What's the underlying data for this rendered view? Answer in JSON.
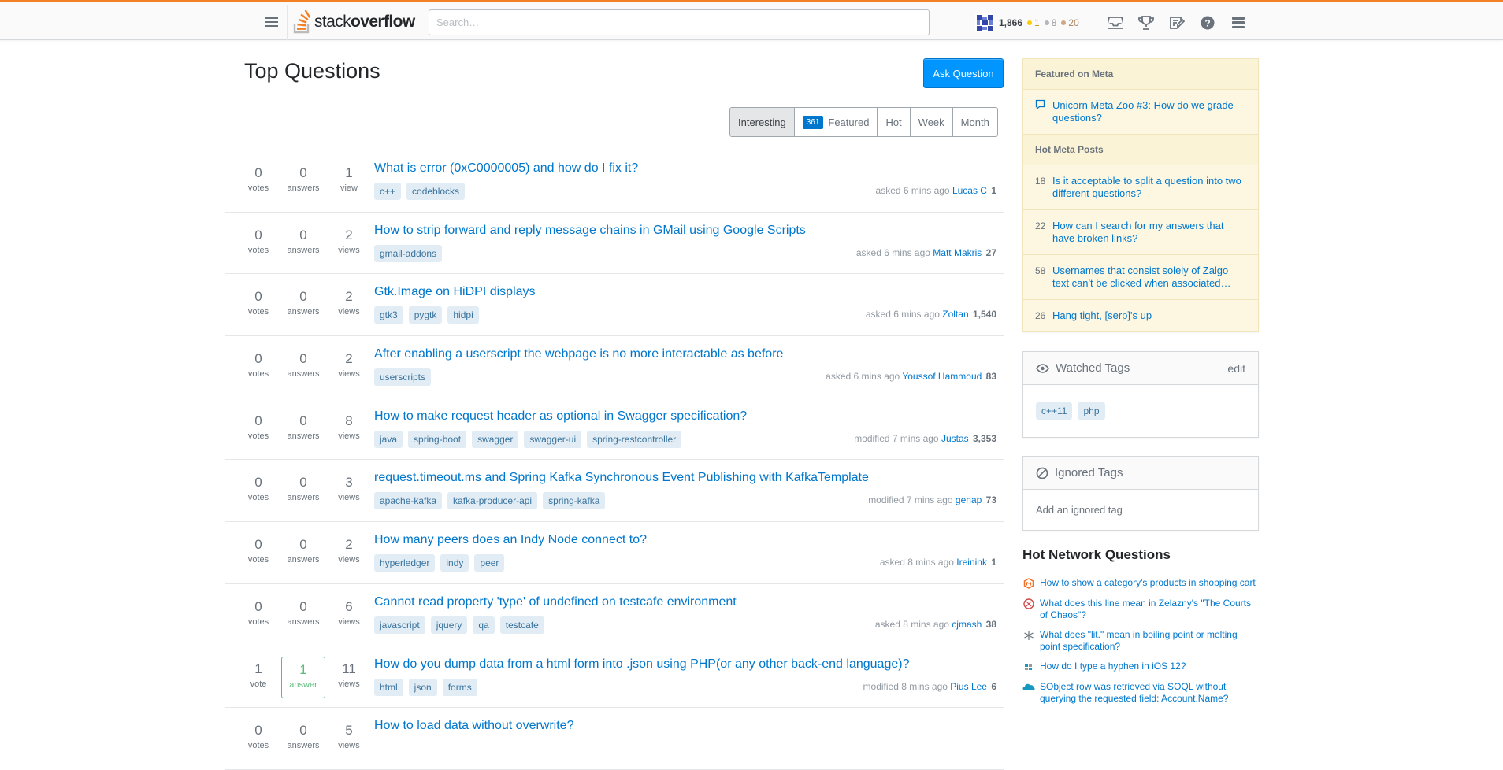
{
  "header": {
    "logo_light": "stack",
    "logo_bold": "overflow",
    "search_placeholder": "Search…",
    "reputation": "1,866",
    "gold": "1",
    "silver": "8",
    "bronze": "20",
    "icons": [
      "inbox-icon",
      "achievements-icon",
      "review-icon",
      "help-icon",
      "site-switcher-icon"
    ]
  },
  "main": {
    "title": "Top Questions",
    "ask_button": "Ask Question",
    "filters": [
      {
        "label": "Interesting",
        "active": true
      },
      {
        "label": "Featured",
        "count": "361"
      },
      {
        "label": "Hot"
      },
      {
        "label": "Week"
      },
      {
        "label": "Month"
      }
    ],
    "questions": [
      {
        "votes": "0",
        "votes_lbl": "votes",
        "answers": "0",
        "answers_lbl": "answers",
        "views": "1",
        "views_lbl": "view",
        "title": "What is error (0xC0000005) and how do I fix it?",
        "tags": [
          "c++",
          "codeblocks"
        ],
        "action": "asked 6 mins ago",
        "user": "Lucas C",
        "rep": "1"
      },
      {
        "votes": "0",
        "votes_lbl": "votes",
        "answers": "0",
        "answers_lbl": "answers",
        "views": "2",
        "views_lbl": "views",
        "title": "How to strip forward and reply message chains in GMail using Google Scripts",
        "tags": [
          "gmail-addons"
        ],
        "action": "asked 6 mins ago",
        "user": "Matt Makris",
        "rep": "27"
      },
      {
        "votes": "0",
        "votes_lbl": "votes",
        "answers": "0",
        "answers_lbl": "answers",
        "views": "2",
        "views_lbl": "views",
        "title": "Gtk.Image on HiDPI displays",
        "tags": [
          "gtk3",
          "pygtk",
          "hidpi"
        ],
        "action": "asked 6 mins ago",
        "user": "Zoltan",
        "rep": "1,540"
      },
      {
        "votes": "0",
        "votes_lbl": "votes",
        "answers": "0",
        "answers_lbl": "answers",
        "views": "2",
        "views_lbl": "views",
        "title": "After enabling a userscript the webpage is no more interactable as before",
        "tags": [
          "userscripts"
        ],
        "action": "asked 6 mins ago",
        "user": "Youssof Hammoud",
        "rep": "83"
      },
      {
        "votes": "0",
        "votes_lbl": "votes",
        "answers": "0",
        "answers_lbl": "answers",
        "views": "8",
        "views_lbl": "views",
        "title": "How to make request header as optional in Swagger specification?",
        "tags": [
          "java",
          "spring-boot",
          "swagger",
          "swagger-ui",
          "spring-restcontroller"
        ],
        "action": "modified 7 mins ago",
        "user": "Justas",
        "rep": "3,353"
      },
      {
        "votes": "0",
        "votes_lbl": "votes",
        "answers": "0",
        "answers_lbl": "answers",
        "views": "3",
        "views_lbl": "views",
        "title": "request.timeout.ms and Spring Kafka Synchronous Event Publishing with KafkaTemplate",
        "tags": [
          "apache-kafka",
          "kafka-producer-api",
          "spring-kafka"
        ],
        "action": "modified 7 mins ago",
        "user": "genap",
        "rep": "73"
      },
      {
        "votes": "0",
        "votes_lbl": "votes",
        "answers": "0",
        "answers_lbl": "answers",
        "views": "2",
        "views_lbl": "views",
        "title": "How many peers does an Indy Node connect to?",
        "tags": [
          "hyperledger",
          "indy",
          "peer"
        ],
        "action": "asked 8 mins ago",
        "user": "Ireinink",
        "rep": "1"
      },
      {
        "votes": "0",
        "votes_lbl": "votes",
        "answers": "0",
        "answers_lbl": "answers",
        "views": "6",
        "views_lbl": "views",
        "title": "Cannot read property 'type' of undefined on testcafe environment",
        "tags": [
          "javascript",
          "jquery",
          "qa",
          "testcafe"
        ],
        "action": "asked 8 mins ago",
        "user": "cjmash",
        "rep": "38"
      },
      {
        "votes": "1",
        "votes_lbl": "vote",
        "answers": "1",
        "answers_lbl": "answer",
        "answered": true,
        "views": "11",
        "views_lbl": "views",
        "title": "How do you dump data from a html form into .json using PHP(or any other back-end language)?",
        "tags": [
          "html",
          "json",
          "forms"
        ],
        "action": "modified 8 mins ago",
        "user": "Pius Lee",
        "rep": "6"
      },
      {
        "votes": "0",
        "votes_lbl": "votes",
        "answers": "0",
        "answers_lbl": "answers",
        "views": "5",
        "views_lbl": "views",
        "title": "How to load data without overwrite?",
        "tags": [],
        "action": "",
        "user": "",
        "rep": ""
      }
    ]
  },
  "sidebar": {
    "featured_meta_head": "Featured on Meta",
    "featured_meta": [
      {
        "text": "Unicorn Meta Zoo #3: How do we grade questions?"
      }
    ],
    "hot_meta_head": "Hot Meta Posts",
    "hot_meta": [
      {
        "count": "18",
        "text": "Is it acceptable to split a question into two different questions?"
      },
      {
        "count": "22",
        "text": "How can I search for my answers that have broken links?"
      },
      {
        "count": "58",
        "text": "Usernames that consist solely of Zalgo text can't be clicked when associated…"
      },
      {
        "count": "26",
        "text": "Hang tight, [serp]'s up"
      }
    ],
    "watched_title": "Watched Tags",
    "watched_edit": "edit",
    "watched_tags": [
      "c++11",
      "php"
    ],
    "ignored_title": "Ignored Tags",
    "ignored_add": "Add an ignored tag",
    "hnq_title": "Hot Network Questions",
    "hnq": [
      {
        "site": "magento-icon",
        "color": "#f46f25",
        "text": "How to show a category's products in shopping cart"
      },
      {
        "site": "scifi-icon",
        "color": "#cc4a4a",
        "text": "What does this line mean in Zelazny's \"The Courts of Chaos\"?"
      },
      {
        "site": "chemistry-icon",
        "color": "#6a737c",
        "text": "What does \"lit.\" mean in boiling point or melting point specification?"
      },
      {
        "site": "apple-icon",
        "color": "#666",
        "text": "How do I type a hyphen in iOS 12?"
      },
      {
        "site": "salesforce-icon",
        "color": "#1798c1",
        "text": "SObject row was retrieved via SOQL without querying the requested field: Account.Name?"
      }
    ]
  }
}
